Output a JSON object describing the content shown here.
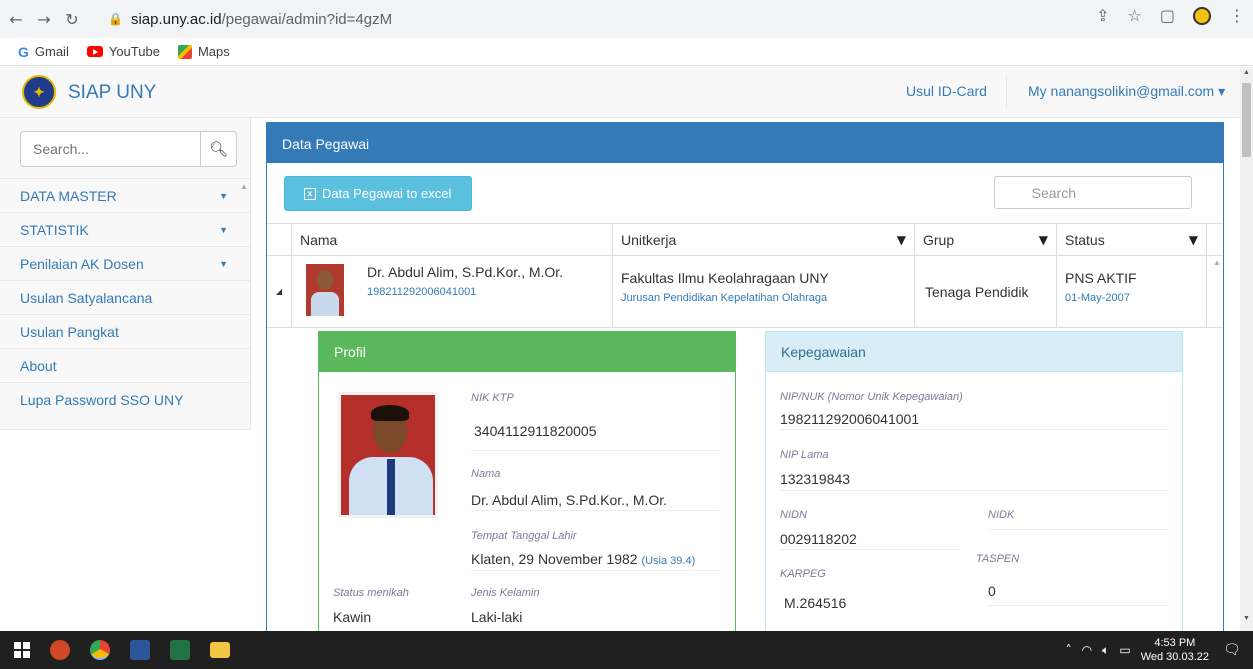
{
  "browser": {
    "url_domain": "siap.uny.ac.id",
    "url_path": "/pegawai/admin?id=4gzM",
    "bookmarks": [
      {
        "label": "Gmail",
        "icon": "gmail-icon"
      },
      {
        "label": "YouTube",
        "icon": "youtube-icon"
      },
      {
        "label": "Maps",
        "icon": "maps-icon"
      }
    ]
  },
  "header": {
    "brand": "SIAP UNY",
    "usul_idcard": "Usul ID-Card",
    "account": "My nanangsolikin@gmail.com ▾"
  },
  "sidebar": {
    "search_placeholder": "Search...",
    "items": [
      {
        "label": "DATA MASTER",
        "has_caret": true
      },
      {
        "label": "STATISTIK",
        "has_caret": true
      },
      {
        "label": "Penilaian AK Dosen",
        "has_caret": true
      },
      {
        "label": "Usulan Satyalancana",
        "has_caret": false
      },
      {
        "label": "Usulan Pangkat",
        "has_caret": false
      },
      {
        "label": "About",
        "has_caret": false
      },
      {
        "label": "Lupa Password SSO UNY",
        "has_caret": false
      }
    ]
  },
  "panel": {
    "title": "Data Pegawai",
    "excel_button": "Data Pegawai to excel",
    "search_placeholder": "Search",
    "columns": [
      "Nama",
      "Unitkerja",
      "Grup",
      "Status"
    ],
    "row": {
      "name": "Dr. Abdul Alim, S.Pd.Kor., M.Or.",
      "nip": "198211292006041001",
      "unit": "Fakultas Ilmu Keolahragaan UNY",
      "jurusan": "Jurusan Pendidikan Kepelatihan Olahraga",
      "grup": "Tenaga Pendidik",
      "status": "PNS AKTIF",
      "status_date": "01-May-2007"
    }
  },
  "profil": {
    "title": "Profil",
    "nik_label": "NIK KTP",
    "nik": "3404112911820005",
    "nama_label": "Nama",
    "nama": "Dr. Abdul Alim, S.Pd.Kor., M.Or.",
    "ttl_label": "Tempat Tanggal Lahir",
    "ttl": "Klaten, 29 November 1982",
    "usia": "(Usia 39.4)",
    "status_label": "Status menikah",
    "status": "Kawin",
    "jk_label": "Jenis Kelamin",
    "jk": "Laki-laki"
  },
  "kepegawaian": {
    "title": "Kepegawaian",
    "nip_label": "NIP/NUK (Nomor Unik Kepegawaian)",
    "nip": "198211292006041001",
    "niplama_label": "NIP Lama",
    "niplama": "132319843",
    "nidn_label": "NIDN",
    "nidn": "0029118202",
    "nidk_label": "NIDK",
    "taspen_label": "TASPEN",
    "taspen": "0",
    "karpeg_label": "KARPEG",
    "karpeg": "M.264516"
  },
  "taskbar": {
    "time": "4:53 PM",
    "date": "Wed 30.03.22"
  }
}
